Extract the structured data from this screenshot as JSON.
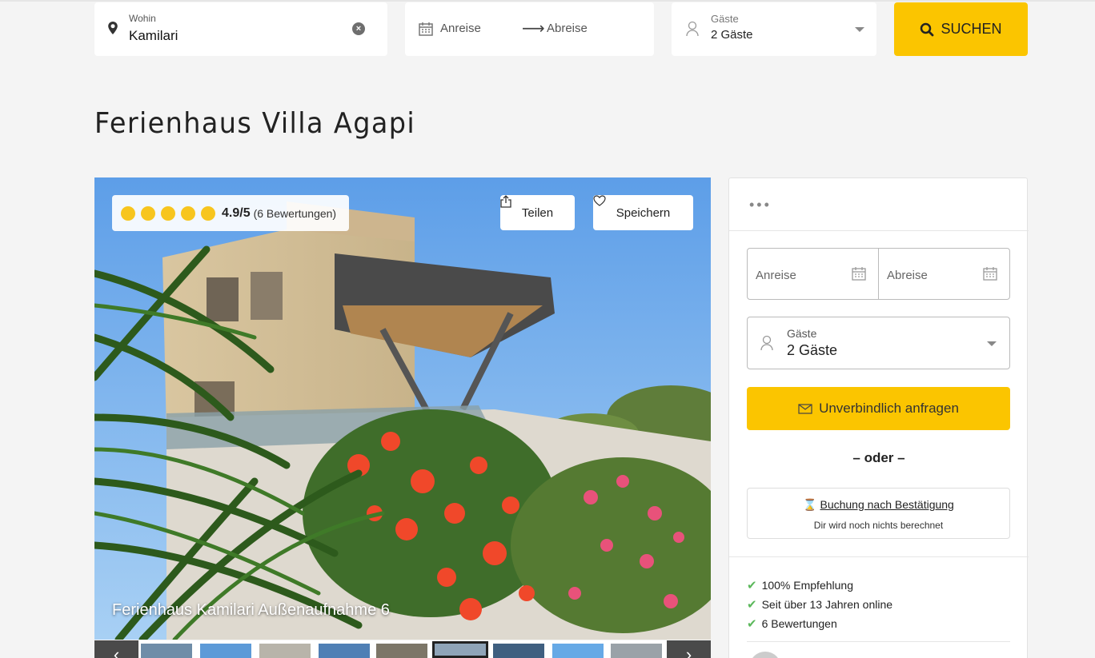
{
  "search": {
    "where_label": "Wohin",
    "where_value": "Kamilari",
    "arrival_placeholder": "Anreise",
    "departure_placeholder": "Abreise",
    "guests_label": "Gäste",
    "guests_value": "2 Gäste",
    "search_button": "SUCHEN"
  },
  "listing": {
    "title": "Ferienhaus Villa Agapi",
    "rating": {
      "stars": 5,
      "score": "4.9/5",
      "count": "(6 Bewertungen)"
    },
    "share_button": "Teilen",
    "save_button": "Speichern",
    "photo_caption": "Ferienhaus Kamilari Außenaufnahme 6",
    "thumbnail_count": 9,
    "active_thumbnail_index": 5
  },
  "booking": {
    "more_menu": "•••",
    "arrival_placeholder": "Anreise",
    "departure_placeholder": "Abreise",
    "guests_label": "Gäste",
    "guests_value": "2 Gäste",
    "inquiry_button": "Unverbindlich anfragen",
    "or_text": "– oder –",
    "confirmation_link": "Buchung nach Bestätigung",
    "confirmation_note": "Dir wird noch nichts berechnet",
    "features": [
      "100% Empfehlung",
      "Seit über 13 Jahren online",
      "6 Bewertungen"
    ]
  },
  "colors": {
    "accent": "#fbc500",
    "rating_dot": "#f7c51e",
    "check": "#5cb85c"
  }
}
